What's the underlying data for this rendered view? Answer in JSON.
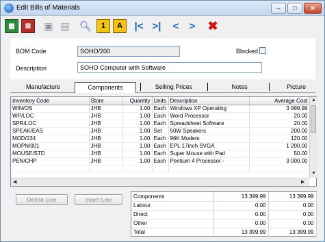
{
  "window": {
    "title": "Edit Bills of Materials",
    "controls": {
      "minimize": "–",
      "maximize": "□",
      "close": "✕"
    }
  },
  "toolbar": {
    "items": [
      {
        "icon": "spreadsheet-icon",
        "glyph": "▦"
      },
      {
        "icon": "delete-record-icon",
        "glyph": "⊠"
      },
      {
        "icon": "save-icon",
        "glyph": "▣"
      },
      {
        "icon": "save-all-icon",
        "glyph": "▤"
      },
      {
        "icon": "search-icon",
        "glyph": "🔍︎"
      },
      {
        "icon": "1",
        "glyph": "1"
      },
      {
        "icon": "a",
        "glyph": "A"
      },
      {
        "icon": "first-record-icon",
        "glyph": "|<"
      },
      {
        "icon": "last-record-icon",
        "glyph": ">|"
      },
      {
        "icon": "previous-record-icon",
        "glyph": "<"
      },
      {
        "icon": "next-record-icon",
        "glyph": ">"
      },
      {
        "icon": "cancel-icon",
        "glyph": "✖"
      }
    ]
  },
  "header": {
    "bom_code_label": "BOM Code",
    "bom_code_value": "SOHO/200",
    "blocked_label": "Blocked",
    "blocked_checked": false,
    "description_label": "Description",
    "description_value": "SOHO Computer with Software"
  },
  "tabs": [
    "Manufacture",
    "Components",
    "Selling Prices",
    "Notes",
    "Picture"
  ],
  "active_tab": "Components",
  "grid": {
    "columns": [
      "Inventory Code",
      "Store",
      "Quantity",
      "Units",
      "Description",
      "Average Cost"
    ],
    "rows": [
      [
        "WIN/OS",
        "JHB",
        "1.00",
        "Each",
        "Windows XP Operating",
        "3 999.99"
      ],
      [
        "WP/LOC",
        "JHB",
        "1.00",
        "Each",
        "Word Processor",
        "20.00"
      ],
      [
        "SPR/LOC",
        "JHB",
        "1.00",
        "Each",
        "Spreadsheet Software",
        "20.00"
      ],
      [
        "SPEAK/EAS",
        "JHB",
        "1.00",
        "Set",
        "50W Speakers",
        "200.00"
      ],
      [
        "MOD/234",
        "JHB",
        "1.00",
        "Each",
        "96K Modem",
        "120.00"
      ],
      [
        "MOPN/001",
        "JHB",
        "1.00",
        "Each",
        "EPL 17inch SVGA",
        "1 200.00"
      ],
      [
        "MOUSE/STD",
        "JHB",
        "1.00",
        "Each",
        "Super Mouse with Pad",
        "50.00"
      ],
      [
        "PEN/CHP",
        "JHB",
        "1.00",
        "Each",
        "Pentium 4 Processor -",
        "3 000.00"
      ],
      [
        "",
        "",
        "",
        "",
        "",
        ""
      ],
      [
        "",
        "",
        "",
        "",
        "",
        ""
      ]
    ]
  },
  "buttons": {
    "delete_line": "Delete Line",
    "insert_line": "Insert Line"
  },
  "totals": {
    "rows": [
      [
        "Components",
        "13 399.99",
        "13 399.99"
      ],
      [
        "Labour",
        "0.00",
        "0.00"
      ],
      [
        "Direct",
        "0.00",
        "0.00"
      ],
      [
        "Other",
        "0.00",
        "0.00"
      ],
      [
        "Total",
        "13 399.99",
        "13 399.99"
      ]
    ]
  }
}
